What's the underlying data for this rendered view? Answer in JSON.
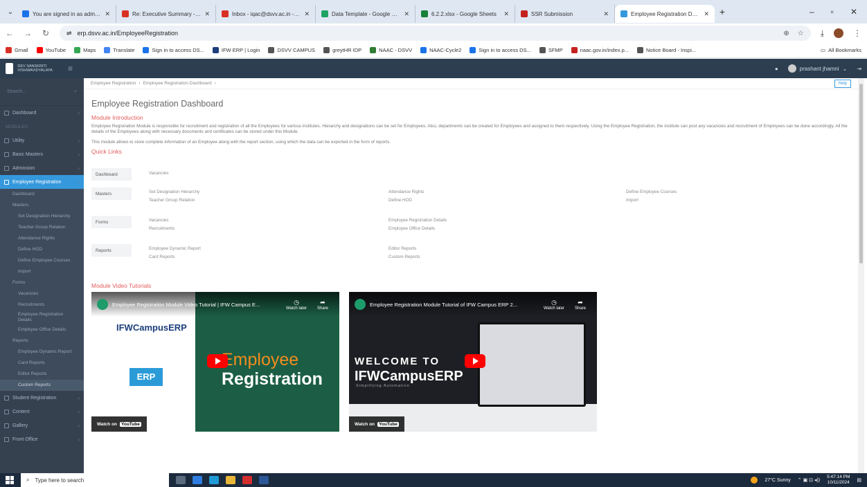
{
  "browser": {
    "tabs": [
      {
        "label": "You are signed in as admin...",
        "color": "#1a73e8"
      },
      {
        "label": "Re: Executive Summary - admin",
        "color": "#d93025"
      },
      {
        "label": "Inbox - iqac@dsvv.ac.in - Dev",
        "color": "#d93025"
      },
      {
        "label": "Data Template - Google Drive",
        "color": "#1ea362"
      },
      {
        "label": "6.2.2.xlsx - Google Sheets",
        "color": "#188038"
      },
      {
        "label": "SSR Submission",
        "color": "#c5221f"
      },
      {
        "label": "Employee Registration Dashbo",
        "color": "#3598dc",
        "active": true
      }
    ],
    "url": "erp.dsvv.ac.in/EmployeeRegistration",
    "bookmarks": [
      {
        "label": "Gmail",
        "color": "#d93025"
      },
      {
        "label": "YouTube",
        "color": "#ff0000"
      },
      {
        "label": "Maps",
        "color": "#34a853"
      },
      {
        "label": "Translate",
        "color": "#4285f4"
      },
      {
        "label": "Sign in to access DS...",
        "color": "#1a73e8"
      },
      {
        "label": "IFW ERP | Login",
        "color": "#1c3f7c"
      },
      {
        "label": "DSVV CAMPUS",
        "color": "#555555"
      },
      {
        "label": "greytHR IDP",
        "color": "#555555"
      },
      {
        "label": "NAAC - DSVV",
        "color": "#2e7d32"
      },
      {
        "label": "NAAC-Cycle2",
        "color": "#1a73e8"
      },
      {
        "label": "Sign in to access DS...",
        "color": "#1a73e8"
      },
      {
        "label": "SFMP",
        "color": "#555555"
      },
      {
        "label": "naac.gov.in/index.p...",
        "color": "#c5221f"
      },
      {
        "label": "Notice Board - Inspi...",
        "color": "#555555"
      }
    ],
    "all_bookmarks": "All Bookmarks"
  },
  "app": {
    "logo_text": "DEV SANSKRITI VISHWAVIDYALAYA",
    "user_name": "prashant jhamni"
  },
  "sidebar": {
    "search_placeholder": "Search...",
    "items": [
      {
        "label": "Dashboard"
      },
      {
        "label": "Utility"
      },
      {
        "label": "Basic Masters"
      },
      {
        "label": "Admission"
      },
      {
        "label": "Employee Registration",
        "active": true
      }
    ],
    "section_modules": "MODULES",
    "sub": [
      {
        "label": "Dashboard",
        "grp": true
      },
      {
        "label": "Masters",
        "grp": true
      },
      {
        "label": "Set Designation Hierarchy"
      },
      {
        "label": "Teacher Group Relation"
      },
      {
        "label": "Attendance Rights"
      },
      {
        "label": "Define HOD"
      },
      {
        "label": "Define Employee Courses"
      },
      {
        "label": "Import"
      },
      {
        "label": "Forms",
        "grp": true
      },
      {
        "label": "Vacancies"
      },
      {
        "label": "Recruitments"
      },
      {
        "label": "Employee Registration Details"
      },
      {
        "label": "Employee Office Details"
      },
      {
        "label": "Reports",
        "grp": true
      },
      {
        "label": "Employee Dynamic Report"
      },
      {
        "label": "Card Reports"
      },
      {
        "label": "Editor Reports"
      },
      {
        "label": "Custom Reports",
        "sel": true
      }
    ],
    "items_after": [
      {
        "label": "Student Registration"
      },
      {
        "label": "Content"
      },
      {
        "label": "Gallery"
      },
      {
        "label": "Front Office"
      }
    ]
  },
  "main": {
    "breadcrumb": [
      "Employee Registration",
      "Employee Registration Dashboard"
    ],
    "help_button": "Help",
    "page_title": "Employee Registration Dashboard",
    "intro_title": "Module Introduction",
    "intro_text": "Employee Registration Module is responsible for recruitment and registration of all the Employees for various institutes. Hierarchy and designations can be set for Employees. Also, departments can be created for Employees and assigned to them respectively. Using the Employee Registration, the institute can post any vacancies and recruitment of Employees can be done accordingly. All the details of the Employees along with necessary documents and certificates can be stored under this Module.",
    "intro_text2": "This module allows to store complete information of an Employee along with the report section, using which the data can be exported in the form of reports.",
    "quick_links_title": "Quick Links",
    "quick_links": {
      "dashboard": {
        "label": "Dashboard",
        "links": [
          "Vacancies"
        ]
      },
      "masters": {
        "label": "Masters",
        "col1": [
          "Set Designation Hierarchy",
          "Teacher Group Relation"
        ],
        "col2": [
          "Attendance Rights",
          "Define HOD"
        ],
        "col3": [
          "Define Employee Courses",
          "Import"
        ]
      },
      "forms": {
        "label": "Forms",
        "col1": [
          "Vacancies",
          "Recruitments"
        ],
        "col2": [
          "Employee Registration Details",
          "Employee Office Details"
        ]
      },
      "reports": {
        "label": "Reports",
        "col1": [
          "Employee Dynamic Report",
          "Card Reports"
        ],
        "col2": [
          "Editor Reports",
          "Custom Reports"
        ]
      }
    },
    "video_title": "Module Video Tutorials",
    "videos": [
      {
        "title": "Employee Registration Module Video Tutorial | IFW Campus E...",
        "watch_later": "Watch later",
        "share": "Share",
        "watch_on": "Watch on",
        "yt": "YouTube",
        "brand": "IFWCampusERP",
        "erp": "ERP",
        "thumb_line1": "Employee",
        "thumb_line2": "Registration"
      },
      {
        "title": "Employee Registration Module Tutorial of IFW Campus ERP 2...",
        "watch_later": "Watch later",
        "share": "Share",
        "watch_on": "Watch on",
        "yt": "YouTube",
        "welcome": "WELCOME TO",
        "brand": "IFWCampusERP",
        "tagline": "Simplifying Automation"
      }
    ]
  },
  "taskbar": {
    "search_placeholder": "Type here to search",
    "weather": "27°C Sunny",
    "time": "5:47:14 PM",
    "date": "10/11/2024"
  }
}
